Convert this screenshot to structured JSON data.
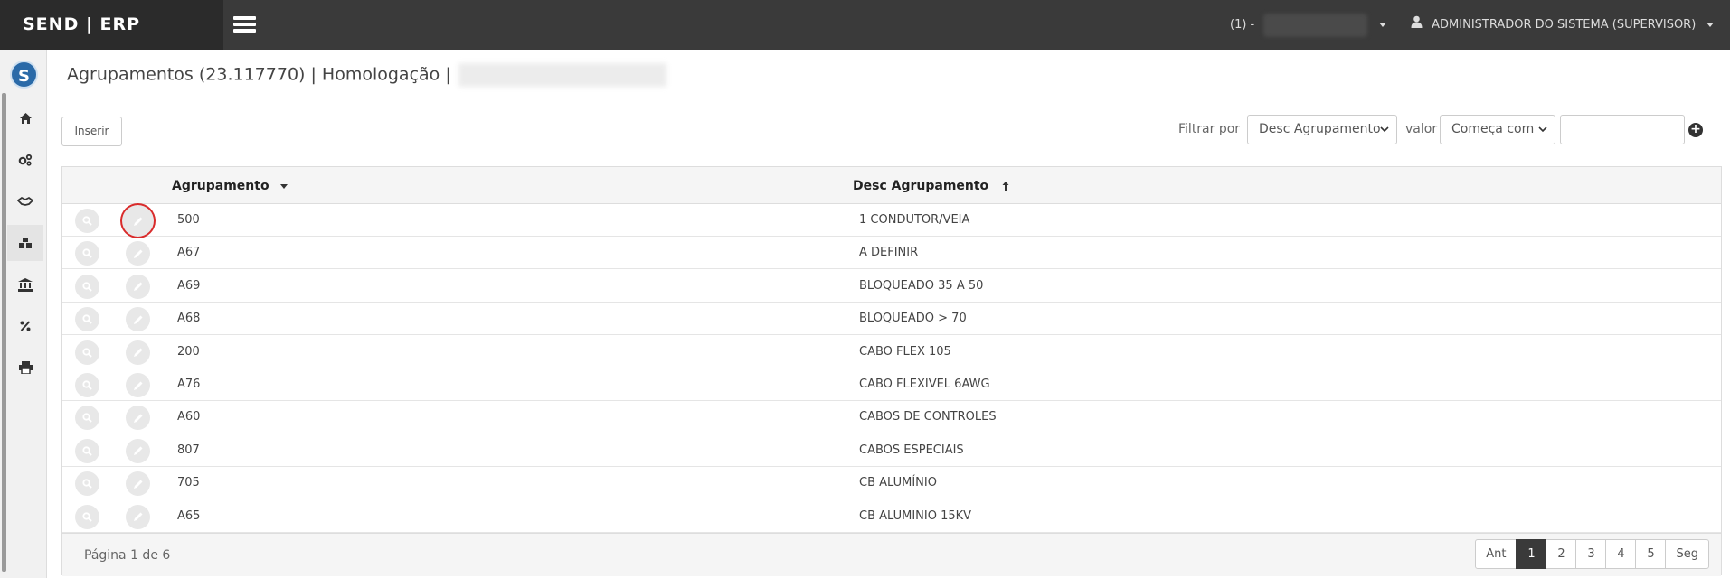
{
  "app": {
    "brand": "SEND | ERP"
  },
  "topbar": {
    "company_label": "(1) -",
    "user_label": "ADMINISTRADOR DO SISTEMA (SUPERVISOR)"
  },
  "sidebar": {
    "logo_letter": "S",
    "items": [
      {
        "icon": "home-icon"
      },
      {
        "icon": "gears-icon"
      },
      {
        "icon": "handshake-icon"
      },
      {
        "icon": "cubes-icon"
      },
      {
        "icon": "bank-icon"
      },
      {
        "icon": "percent-icon"
      },
      {
        "icon": "print-icon"
      }
    ]
  },
  "header": {
    "title": "Agrupamentos (23.117770) | Homologação |"
  },
  "toolbar": {
    "insert_label": "Inserir",
    "filter_by_label": "Filtrar por",
    "filter_field_value": "Desc Agrupamento",
    "value_label": "valor",
    "filter_op_value": "Começa com",
    "filter_text_value": ""
  },
  "table": {
    "columns": [
      "Agrupamento",
      "Desc Agrupamento"
    ],
    "rows": [
      {
        "code": "500",
        "desc": "1 CONDUTOR/VEIA"
      },
      {
        "code": "A67",
        "desc": "A DEFINIR"
      },
      {
        "code": "A69",
        "desc": "BLOQUEADO 35 A 50"
      },
      {
        "code": "A68",
        "desc": "BLOQUEADO > 70"
      },
      {
        "code": "200",
        "desc": "CABO FLEX 105"
      },
      {
        "code": "A76",
        "desc": "CABO FLEXIVEL 6AWG"
      },
      {
        "code": "A60",
        "desc": "CABOS DE CONTROLES"
      },
      {
        "code": "807",
        "desc": "CABOS ESPECIAIS"
      },
      {
        "code": "705",
        "desc": "CB ALUMÍNIO"
      },
      {
        "code": "A65",
        "desc": "CB ALUMINIO 15KV"
      }
    ]
  },
  "pagination": {
    "info": "Página 1 de 6",
    "prev": "Ant",
    "pages": [
      "1",
      "2",
      "3",
      "4",
      "5"
    ],
    "next": "Seg",
    "current": "1"
  },
  "colors": {
    "topbar": "#3a3a3a",
    "brand_bg": "#2b2b2b",
    "highlight": "#d92b2b",
    "logo": "#2a6aa8"
  }
}
